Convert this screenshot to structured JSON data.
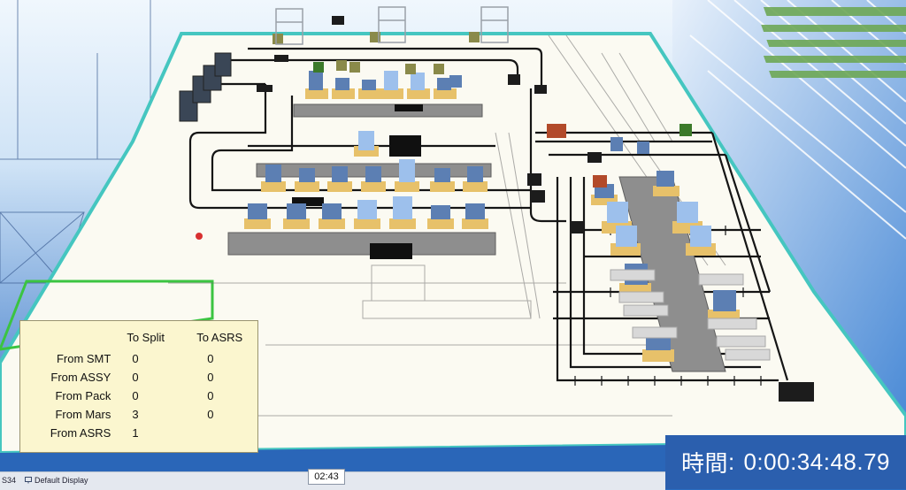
{
  "stats": {
    "col_headers": [
      "To Split",
      "To ASRS"
    ],
    "rows": [
      {
        "label": "From SMT",
        "to_split": "0",
        "to_asrs": "0"
      },
      {
        "label": "From ASSY",
        "to_split": "0",
        "to_asrs": "0"
      },
      {
        "label": "From Pack",
        "to_split": "0",
        "to_asrs": "0"
      },
      {
        "label": "From Mars",
        "to_split": "3",
        "to_asrs": "0"
      },
      {
        "label": "From ASRS",
        "to_split": "1",
        "to_asrs": ""
      }
    ]
  },
  "clock": {
    "label": "時間",
    "value": "0:00:34:48.79"
  },
  "taskbar": {
    "left_fragment": "S34",
    "display_label": "Default Display",
    "timer": "02:43"
  },
  "colors": {
    "floor": "#fbfaf2",
    "conveyor_dark": "#1a1a1a",
    "conveyor_gray": "#8c8c8c",
    "machine_blue": "#5c7fb3",
    "machine_light_blue": "#9dc0ec",
    "pallet_yellow": "#e7c16a",
    "robot_red": "#b24a2a",
    "robot_green": "#3c7a2a",
    "panel_yellow": "#fbf6cf",
    "clock_blue": "#2b5fae",
    "sky_blue": "#5ba2e0"
  },
  "icons": {
    "display_icon": "monitor-icon"
  }
}
